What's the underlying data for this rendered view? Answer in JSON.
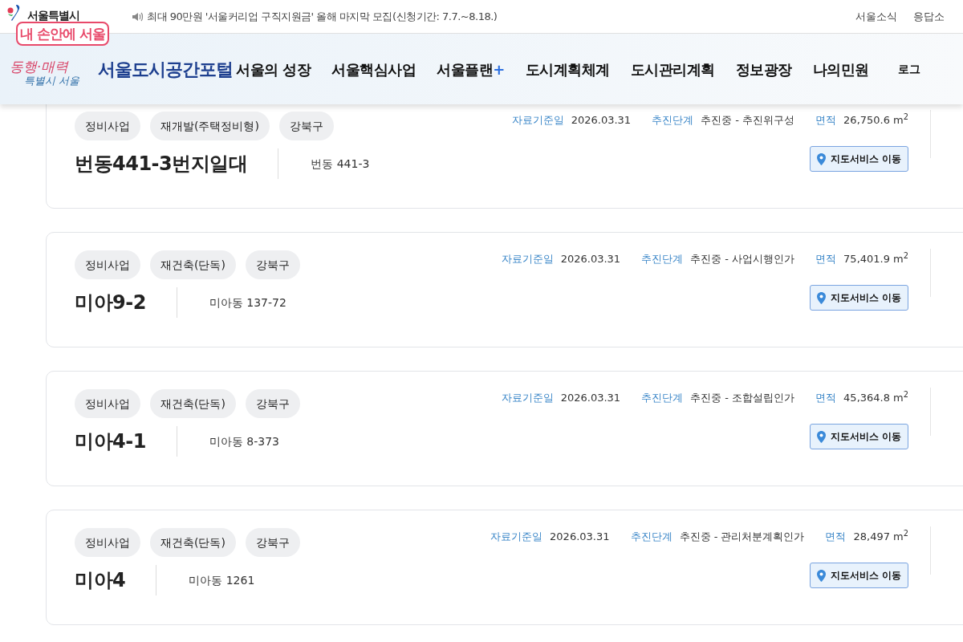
{
  "top_bar": {
    "brand": "서울특별시",
    "notice": "최대 90만원 '서울커리업 구직지원금' 올해 마지막 모집(신청기간: 7.7.~8.18.)",
    "links": [
      "서울소식",
      "응답소"
    ]
  },
  "header": {
    "app_badge": "내 손안에 서울",
    "slogan_top": "동행·매력",
    "slogan_bottom": "특별시 서울",
    "title": "서울도시공간포털",
    "nav": [
      {
        "label": "서울의 성장"
      },
      {
        "label": "서울핵심사업"
      },
      {
        "label": "서울플랜",
        "plus": "+"
      },
      {
        "label": "도시계획체계"
      },
      {
        "label": "도시관리계획"
      },
      {
        "label": "정보광장"
      },
      {
        "label": "나의민원"
      }
    ],
    "login": "로그"
  },
  "projects": [
    {
      "tags": [
        "정비사업",
        "재개발(주택정비형)",
        "강북구"
      ],
      "name": "번동441-3번지일대",
      "address": "번동 441-3",
      "date_label": "자료기준일",
      "date": "2026.03.31",
      "stage_label": "추진단계",
      "stage": "추진중 - 추진위구성",
      "area_label": "면적",
      "area": "26,750.6 m$^{2}$",
      "button": "지도서비스 이동"
    },
    {
      "tags": [
        "정비사업",
        "재건축(단독)",
        "강북구"
      ],
      "name": "미아9-2",
      "address": "미아동 137-72",
      "date_label": "자료기준일",
      "date": "2026.03.31",
      "stage_label": "추진단계",
      "stage": "추진중 - 사업시행인가",
      "area_label": "면적",
      "area": "75,401.9 m$^{2}$",
      "button": "지도서비스 이동"
    },
    {
      "tags": [
        "정비사업",
        "재건축(단독)",
        "강북구"
      ],
      "name": "미아4-1",
      "address": "미아동 8-373",
      "date_label": "자료기준일",
      "date": "2026.03.31",
      "stage_label": "추진단계",
      "stage": "추진중 - 조합설립인가",
      "area_label": "면적",
      "area": "45,364.8 m$^{2}$",
      "button": "지도서비스 이동"
    },
    {
      "tags": [
        "정비사업",
        "재건축(단독)",
        "강북구"
      ],
      "name": "미아4",
      "address": "미아동 1261",
      "date_label": "자료기준일",
      "date": "2026.03.31",
      "stage_label": "추진단계",
      "stage": "추진중 - 관리처분계획인가",
      "area_label": "면적",
      "area": "28,497 m$^{2}$",
      "button": "지도서비스 이동"
    }
  ]
}
